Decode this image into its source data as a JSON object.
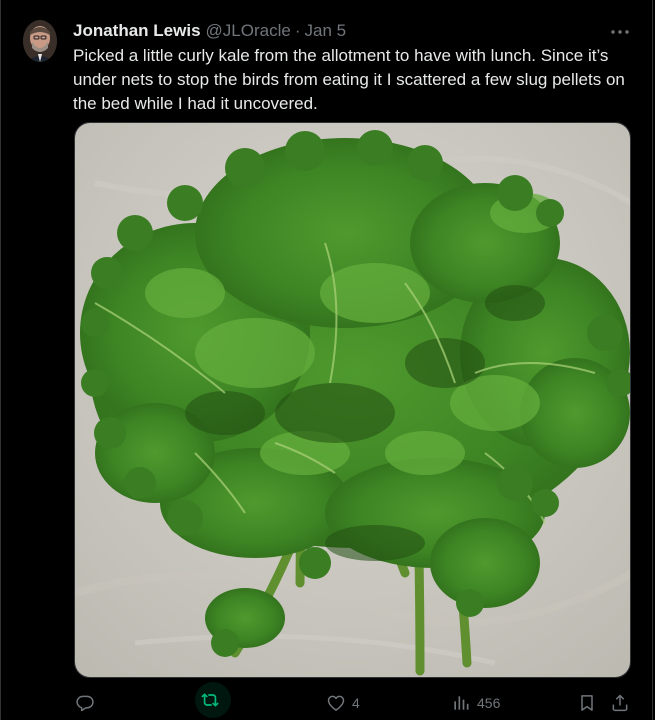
{
  "tweet": {
    "author_name": "Jonathan Lewis",
    "author_handle": "@JLOracle",
    "separator": "·",
    "date": "Jan 5",
    "text": "Picked a little curly kale from the allotment to have with lunch. Since it’s under nets to stop the birds from eating it I scattered a few slug pellets on the bed while I had it uncovered.",
    "media_icon": "kale-photo"
  },
  "actions": {
    "reply": {
      "icon": "reply-icon",
      "count": ""
    },
    "retweet": {
      "icon": "retweet-icon",
      "count": "",
      "active": true,
      "color": "#00ba7c"
    },
    "like": {
      "icon": "heart-icon",
      "count": "4"
    },
    "views": {
      "icon": "views-icon",
      "count": "456"
    },
    "bookmark": {
      "icon": "bookmark-icon"
    },
    "share": {
      "icon": "share-icon"
    }
  },
  "colors": {
    "background": "#000000",
    "text": "#e7e9ea",
    "secondary": "#71767b",
    "border": "#2f3336",
    "retweet_active": "#00ba7c"
  }
}
